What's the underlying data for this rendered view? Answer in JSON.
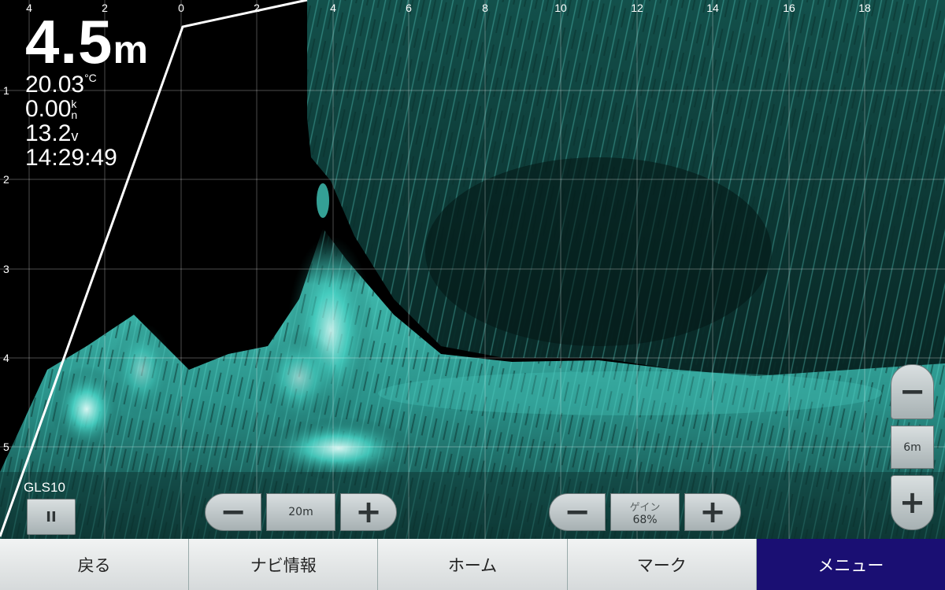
{
  "readout": {
    "depth_value": "4.5",
    "depth_unit": "m",
    "temperature_value": "20.03",
    "temperature_unit": "°C",
    "speed_value": "0.00",
    "speed_unit_top": "k",
    "speed_unit_bottom": "n",
    "voltage_value": "13.2",
    "voltage_unit": "v",
    "time": "14:29:49"
  },
  "x_axis_ticks": [
    "4",
    "2",
    "0",
    "2",
    "4",
    "6",
    "8",
    "10",
    "12",
    "14",
    "16",
    "18"
  ],
  "y_axis_ticks": [
    "1",
    "2",
    "3",
    "4",
    "5"
  ],
  "source": {
    "label": "GLS10",
    "pause_symbol": "II"
  },
  "range_control": {
    "minus_symbol": "−",
    "value": "20m",
    "plus_symbol": "+"
  },
  "gain_control": {
    "minus_symbol": "−",
    "label": "ゲイン",
    "value": "68%",
    "plus_symbol": "+"
  },
  "zoom_control": {
    "minus_symbol": "−",
    "value": "6m",
    "plus_symbol": "+"
  },
  "bottom_tabs": [
    {
      "label": "戻る"
    },
    {
      "label": "ナビ情報"
    },
    {
      "label": "ホーム"
    },
    {
      "label": "マーク"
    },
    {
      "label": "メニュー",
      "active": true
    }
  ],
  "colors": {
    "sonar_echo": "#34c7b9",
    "active_tab": "#1a0f73"
  }
}
